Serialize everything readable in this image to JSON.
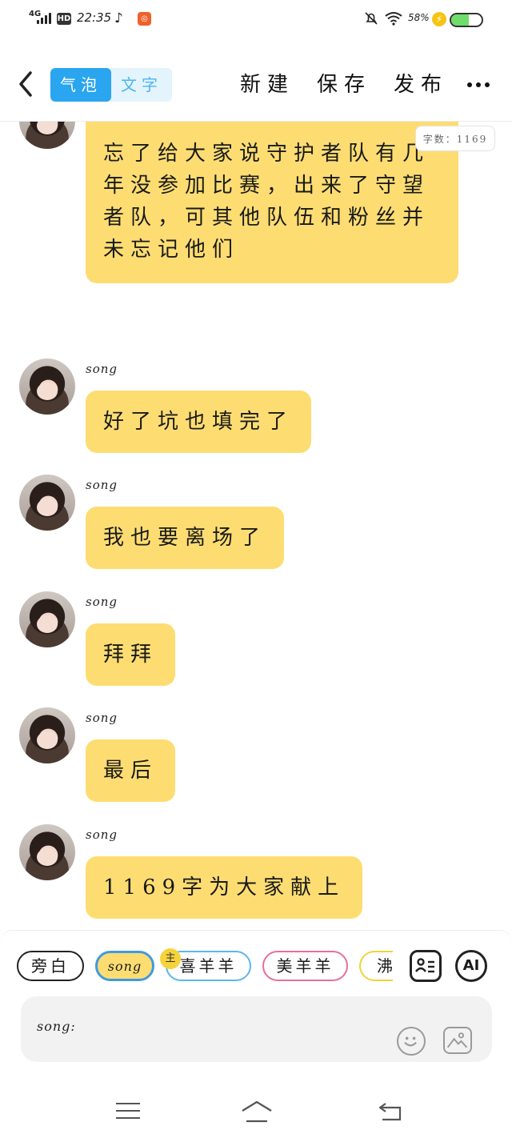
{
  "status_bar": {
    "network": "4G",
    "hd": "HD",
    "time": "22:35",
    "battery_pct": "58%",
    "battery_level": 0.58
  },
  "header": {
    "tabs": [
      {
        "label": "气泡",
        "active": true
      },
      {
        "label": "文字",
        "active": false
      }
    ],
    "actions": [
      {
        "label": "新建"
      },
      {
        "label": "保存"
      },
      {
        "label": "发布"
      }
    ]
  },
  "chat": {
    "word_count": "字数：1169",
    "messages": [
      {
        "sender": "",
        "text": "忘了给大家说守护者队有几年没参加比赛，出来了守望者队，可其他队伍和粉丝并未忘记他们"
      },
      {
        "sender": "song",
        "text": "好了坑也填完了"
      },
      {
        "sender": "song",
        "text": "我也要离场了"
      },
      {
        "sender": "song",
        "text": "拜拜"
      },
      {
        "sender": "song",
        "text": "最后"
      },
      {
        "sender": "song",
        "text": "1169字为大家献上"
      }
    ]
  },
  "composer": {
    "roles": [
      {
        "label": "旁白"
      },
      {
        "label": "song"
      },
      {
        "label": "喜羊羊"
      },
      {
        "label": "美羊羊"
      },
      {
        "label": "沸"
      }
    ],
    "main_badge": "主",
    "ai_label": "AI",
    "input_prefix": "song:"
  },
  "colors": {
    "bubble": "#fddd72",
    "accent": "#2aa5ef"
  }
}
